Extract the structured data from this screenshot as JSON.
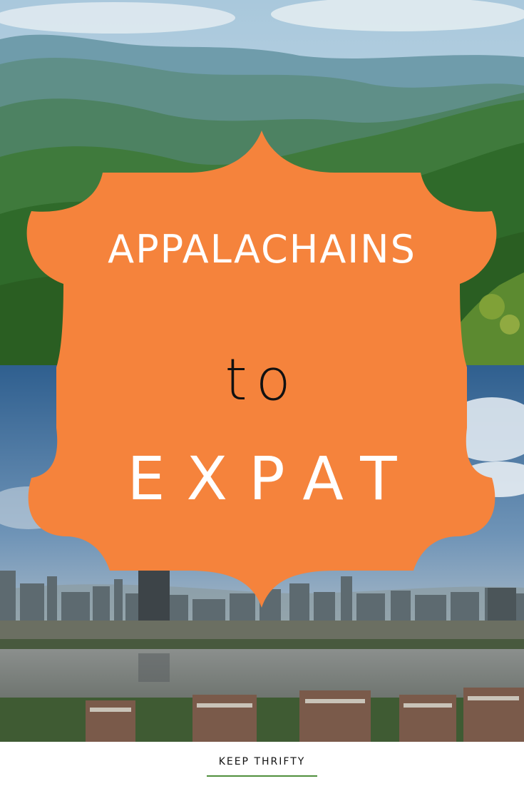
{
  "title": {
    "line1": "APPALACHAINS",
    "line2": "to",
    "line3": "EXPAT"
  },
  "footer": {
    "brand": "KEEP THRIFTY"
  },
  "colors": {
    "badge": "#f5833c",
    "title_text": "#ffffff",
    "connector_text": "#111111",
    "brand_rule": "#4f8f3c"
  },
  "images": {
    "top": "forested-mountain-ridges",
    "bottom": "city-skyline-over-lake"
  }
}
